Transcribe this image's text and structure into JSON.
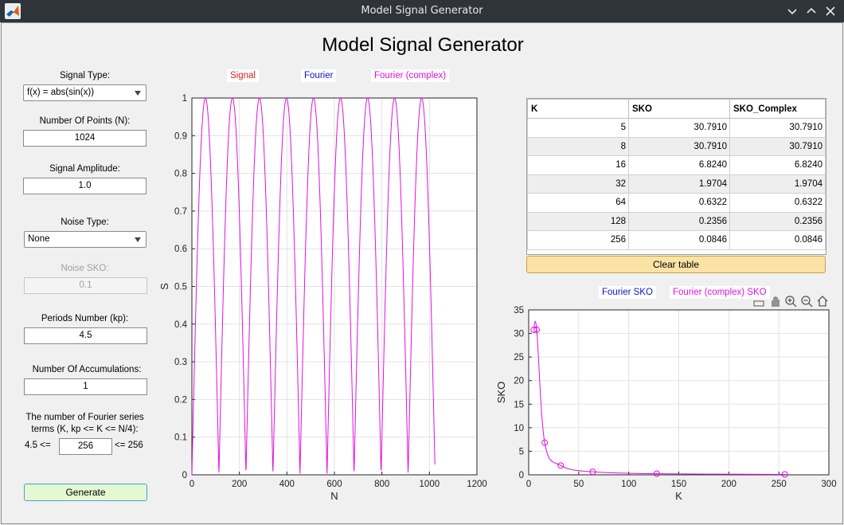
{
  "window": {
    "title": "Model Signal Generator"
  },
  "app_title": "Model Signal Generator",
  "controls": {
    "signal_type_label": "Signal Type:",
    "signal_type_value": "f(x) = abs(sin(x))",
    "num_points_label": "Number Of Points (N):",
    "num_points_value": "1024",
    "amplitude_label": "Signal Amplitude:",
    "amplitude_value": "1.0",
    "noise_type_label": "Noise Type:",
    "noise_type_value": "None",
    "noise_sko_label": "Noise SKO:",
    "noise_sko_value": "0.1",
    "periods_label": "Periods Number (kp):",
    "periods_value": "4.5",
    "accum_label": "Number Of Accumulations:",
    "accum_value": "1",
    "fourier_terms_label_line1": "The number of Fourier series",
    "fourier_terms_label_line2": "terms (K, kp <= K <= N/4):",
    "fourier_lower": "4.5 <=",
    "fourier_value": "256",
    "fourier_upper": "<= 256",
    "generate_label": "Generate"
  },
  "main_plot": {
    "legend": [
      "Signal",
      "Fourier",
      "Fourier (complex)"
    ],
    "legend_colors": [
      "#e02020",
      "#1010d0",
      "#e010e0"
    ]
  },
  "table": {
    "headers": [
      "K",
      "SKO",
      "SKO_Complex"
    ],
    "rows": [
      [
        "5",
        "30.7910",
        "30.7910"
      ],
      [
        "8",
        "30.7910",
        "30.7910"
      ],
      [
        "16",
        "6.8240",
        "6.8240"
      ],
      [
        "32",
        "1.9704",
        "1.9704"
      ],
      [
        "64",
        "0.6322",
        "0.6322"
      ],
      [
        "128",
        "0.2356",
        "0.2356"
      ],
      [
        "256",
        "0.0846",
        "0.0846"
      ]
    ],
    "clear_label": "Clear table"
  },
  "sko_plot": {
    "legend": [
      "Fourier SKO",
      "Fourier (complex) SKO"
    ],
    "legend_colors": [
      "#1010d0",
      "#e010e0"
    ]
  },
  "chart_data": [
    {
      "type": "line",
      "title": "",
      "xlabel": "N",
      "ylabel": "S",
      "xlim": [
        0,
        1200
      ],
      "ylim": [
        0,
        1
      ],
      "xticks": [
        0,
        200,
        400,
        600,
        800,
        1000,
        1200
      ],
      "yticks": [
        0,
        0.1,
        0.2,
        0.3,
        0.4,
        0.5,
        0.6,
        0.7,
        0.8,
        0.9,
        1
      ],
      "grid": true,
      "series": [
        {
          "name": "Fourier (complex)",
          "color": "#e010e0",
          "function": "abs(sin(x))",
          "n_points": 1024,
          "periods": 4.5
        }
      ]
    },
    {
      "type": "line",
      "title": "",
      "xlabel": "K",
      "ylabel": "SKO",
      "xlim": [
        0,
        300
      ],
      "ylim": [
        0,
        35
      ],
      "xticks": [
        0,
        50,
        100,
        150,
        200,
        250,
        300
      ],
      "yticks": [
        0,
        5,
        10,
        15,
        20,
        25,
        30,
        35
      ],
      "grid": true,
      "x": [
        5,
        8,
        16,
        32,
        64,
        128,
        256
      ],
      "series": [
        {
          "name": "Fourier (complex) SKO",
          "color": "#e010e0",
          "values": [
            30.791,
            30.791,
            6.824,
            1.9704,
            0.6322,
            0.2356,
            0.0846
          ]
        }
      ]
    }
  ]
}
